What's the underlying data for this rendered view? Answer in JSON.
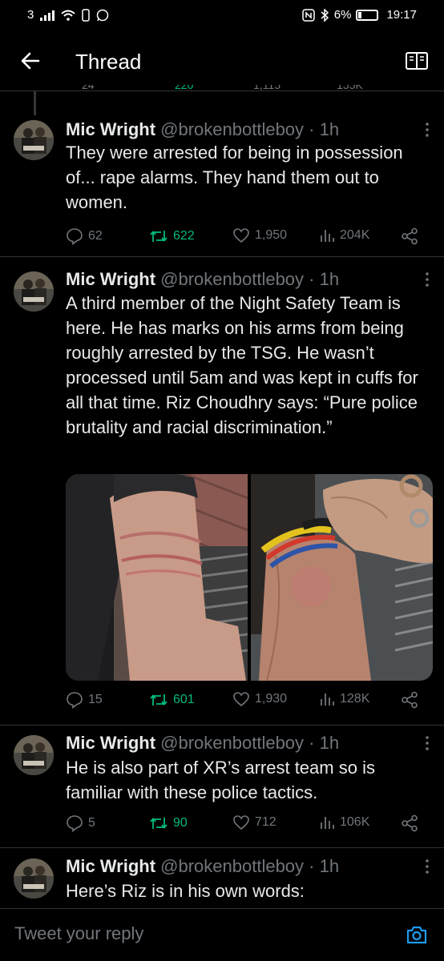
{
  "status_bar": {
    "carrier": "3",
    "battery": "6%",
    "time": "19:17"
  },
  "header": {
    "title": "Thread"
  },
  "previous_actions": {
    "replies": "24",
    "retweets": "220",
    "likes": "1,115",
    "views": "155K"
  },
  "tweets": [
    {
      "name": "Mic Wright",
      "handle": "@brokenbottleboy",
      "time": "· 1h",
      "text": "They were arrested for being in possession of... rape alarms. They hand them out to women.",
      "replies": "62",
      "retweets": "622",
      "likes": "1,950",
      "views": "204K"
    },
    {
      "name": "Mic Wright",
      "handle": "@brokenbottleboy",
      "time": "· 1h",
      "text": "A third member of the Night Safety Team is here. He has marks on his arms from being roughly arrested by the TSG. He wasn’t processed until 5am and was kept in cuffs for all that time. Riz Choudhry says: “Pure police brutality and racial discrimination.”",
      "replies": "15",
      "retweets": "601",
      "likes": "1,930",
      "views": "128K"
    },
    {
      "name": "Mic Wright",
      "handle": "@brokenbottleboy",
      "time": "· 1h",
      "text": "He is also part of XR’s arrest team so is familiar with these police tactics.",
      "replies": "5",
      "retweets": "90",
      "likes": "712",
      "views": "106K"
    },
    {
      "name": "Mic Wright",
      "handle": "@brokenbottleboy",
      "time": "· 1h",
      "text": "Here’s Riz is in his own words:"
    }
  ],
  "reply": {
    "placeholder": "Tweet your reply"
  },
  "colors": {
    "background": "#000000",
    "accent": "#1d9bf0",
    "retweet": "#00ba7c",
    "muted": "#71767b"
  }
}
